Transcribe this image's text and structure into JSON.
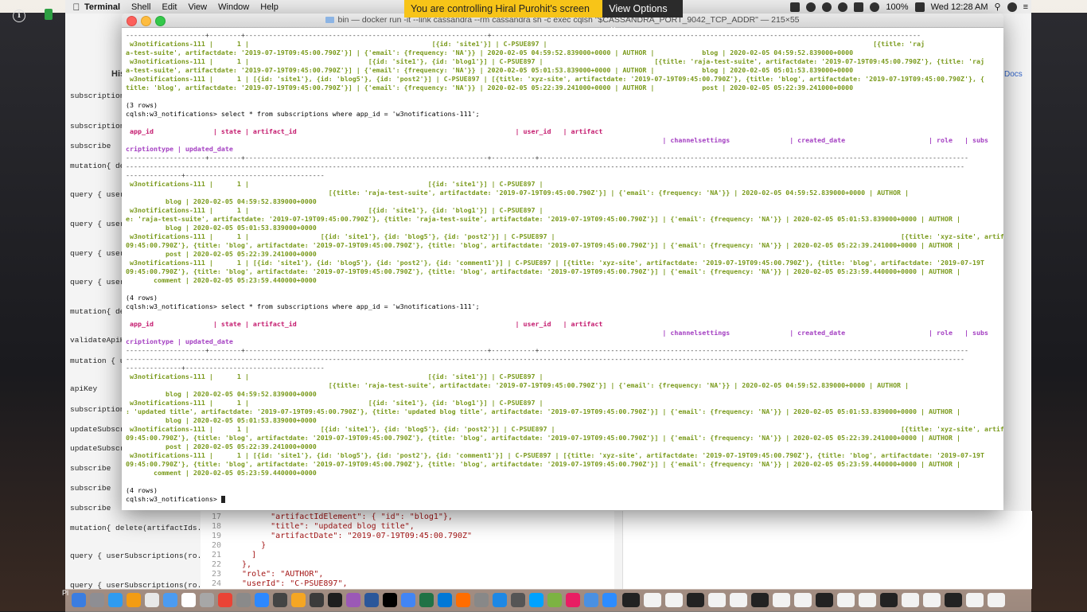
{
  "menubar": {
    "app_name": "Terminal",
    "items": [
      "Shell",
      "Edit",
      "View",
      "Window",
      "Help"
    ],
    "battery": "100%",
    "clock": "Wed 12:28 AM"
  },
  "share_banner": {
    "message": "You are controlling Hiral Purohit's screen",
    "options_label": "View Options"
  },
  "terminal": {
    "title": "bin — docker run -it --link cassandra --rm cassandra sh -c exec cqlsh \"$CASSANDRA_PORT_9042_TCP_ADDR\" — 215×55",
    "lines": [
      {
        "t": "--------------------+--------+-------------------------------------------------------------+------------------------------------------------------------------------------------------------------------",
        "c": "sep"
      },
      {
        "t": " w3notifications-111 |      1 |                                              [{id: 'site1'}] | C-PSUE897 |                                                                                  [{title: 'raj",
        "c": "row"
      },
      {
        "t": "a-test-suite', artifactdate: '2019-07-19T09:45:00.790Z'}] | {'email': {frequency: 'NA'}} | 2020-02-05 04:59:52.839000+0000 | AUTHOR |            blog | 2020-02-05 04:59:52.839000+0000",
        "c": "row"
      },
      {
        "t": " w3notifications-111 |      1 |                              [{id: 'site1'}, {id: 'blog1'}] | C-PSUE897 |                            [{title: 'raja-test-suite', artifactdate: '2019-07-19T09:45:00.790Z'}, {title: 'raj",
        "c": "row"
      },
      {
        "t": "a-test-suite', artifactdate: '2019-07-19T09:45:00.790Z'}] | {'email': {frequency: 'NA'}} | 2020-02-05 05:01:53.839000+0000 | AUTHOR |            blog | 2020-02-05 05:01:53.839000+0000",
        "c": "row"
      },
      {
        "t": " w3notifications-111 |      1 | [{id: 'site1'}, {id: 'blog5'}, {id: 'post2'}] | C-PSUE897 | [{title: 'xyz-site', artifactdate: '2019-07-19T09:45:00.790Z'}, {title: 'blog', artifactdate: '2019-07-19T09:45:00.790Z'}, {",
        "c": "row"
      },
      {
        "t": "title: 'blog', artifactdate: '2019-07-19T09:45:00.790Z'}] | {'email': {frequency: 'NA'}} | 2020-02-05 05:22:39.241000+0000 | AUTHOR |            post | 2020-02-05 05:22:39.241000+0000",
        "c": "row"
      },
      {
        "t": "",
        "c": "rows-count"
      },
      {
        "t": "(3 rows)",
        "c": "rows-count"
      },
      {
        "t": "cqlsh:w3_notifications> select * from subscriptions where app_id = 'w3notifications-111';",
        "c": "prompt"
      },
      {
        "t": "",
        "c": "rows-count"
      },
      {
        "t": " app_id               | state | artifact_id                                                       | user_id   | artifact",
        "c": "hdr-red"
      },
      {
        "t": "                                                                                                                                       | channelsettings               | created_date                     | role   | subs",
        "c": "hdr-mag"
      },
      {
        "t": "criptiontype | updated_date",
        "c": "hdr-mag"
      },
      {
        "t": "--------------------+--------+-------------------------------------------------------------+-----------+------------------------------------------------------------------------------------------------------------",
        "c": "sep"
      },
      {
        "t": "-------------------------------------------------------------------------------------------------------------------------------------------------------------------------------------------------------------------",
        "c": "sep"
      },
      {
        "t": "--------------+-----------------------------------",
        "c": "sep"
      },
      {
        "t": " w3notifications-111 |      1 |                                             [{id: 'site1'}] | C-PSUE897 |",
        "c": "row"
      },
      {
        "t": "                                                   [{title: 'raja-test-suite', artifactdate: '2019-07-19T09:45:00.790Z'}] | {'email': {frequency: 'NA'}} | 2020-02-05 04:59:52.839000+0000 | AUTHOR |",
        "c": "row"
      },
      {
        "t": "          blog | 2020-02-05 04:59:52.839000+0000",
        "c": "row"
      },
      {
        "t": " w3notifications-111 |      1 |                              [{id: 'site1'}, {id: 'blog1'}] | C-PSUE897 |                                                                                                                       [{titl",
        "c": "row"
      },
      {
        "t": "e: 'raja-test-suite', artifactdate: '2019-07-19T09:45:00.790Z'}, {title: 'raja-test-suite', artifactdate: '2019-07-19T09:45:00.790Z'}] | {'email': {frequency: 'NA'}} | 2020-02-05 05:01:53.839000+0000 | AUTHOR |",
        "c": "row"
      },
      {
        "t": "          blog | 2020-02-05 05:01:53.839000+0000",
        "c": "row"
      },
      {
        "t": " w3notifications-111 |      1 |                  [{id: 'site1'}, {id: 'blog5'}, {id: 'post2'}] | C-PSUE897 |                                                                                       [{title: 'xyz-site', artifactdate: '2019-07-19T",
        "c": "row"
      },
      {
        "t": "09:45:00.790Z'}, {title: 'blog', artifactdate: '2019-07-19T09:45:00.790Z'}, {title: 'blog', artifactdate: '2019-07-19T09:45:00.790Z'}] | {'email': {frequency: 'NA'}} | 2020-02-05 05:22:39.241000+0000 | AUTHOR |",
        "c": "row"
      },
      {
        "t": "          post | 2020-02-05 05:22:39.241000+0000",
        "c": "row"
      },
      {
        "t": " w3notifications-111 |      1 | [{id: 'site1'}, {id: 'blog5'}, {id: 'post2'}, {id: 'comment1'}] | C-PSUE897 | [{title: 'xyz-site', artifactdate: '2019-07-19T09:45:00.790Z'}, {title: 'blog', artifactdate: '2019-07-19T",
        "c": "row"
      },
      {
        "t": "09:45:00.790Z'}, {title: 'blog', artifactdate: '2019-07-19T09:45:00.790Z'}, {title: 'blog', artifactdate: '2019-07-19T09:45:00.790Z'}] | {'email': {frequency: 'NA'}} | 2020-02-05 05:23:59.440000+0000 | AUTHOR |",
        "c": "row"
      },
      {
        "t": "       comment | 2020-02-05 05:23:59.440000+0000",
        "c": "row"
      },
      {
        "t": "",
        "c": "rows-count"
      },
      {
        "t": "(4 rows)",
        "c": "rows-count"
      },
      {
        "t": "cqlsh:w3_notifications> select * from subscriptions where app_id = 'w3notifications-111';",
        "c": "prompt"
      },
      {
        "t": "",
        "c": "rows-count"
      },
      {
        "t": " app_id               | state | artifact_id                                                       | user_id   | artifact",
        "c": "hdr-red"
      },
      {
        "t": "                                                                                                                                       | channelsettings               | created_date                     | role   | subs",
        "c": "hdr-mag"
      },
      {
        "t": "criptiontype | updated_date",
        "c": "hdr-mag"
      },
      {
        "t": "--------------------+--------+-------------------------------------------------------------+-----------+------------------------------------------------------------------------------------------------------------",
        "c": "sep"
      },
      {
        "t": "-------------------------------------------------------------------------------------------------------------------------------------------------------------------------------------------------------------------",
        "c": "sep"
      },
      {
        "t": "--------------+-----------------------------------",
        "c": "sep"
      },
      {
        "t": " w3notifications-111 |      1 |                                             [{id: 'site1'}] | C-PSUE897 |",
        "c": "row"
      },
      {
        "t": "                                                   [{title: 'raja-test-suite', artifactdate: '2019-07-19T09:45:00.790Z'}] | {'email': {frequency: 'NA'}} | 2020-02-05 04:59:52.839000+0000 | AUTHOR |",
        "c": "row"
      },
      {
        "t": "          blog | 2020-02-05 04:59:52.839000+0000",
        "c": "row"
      },
      {
        "t": " w3notifications-111 |      1 |                              [{id: 'site1'}, {id: 'blog1'}] | C-PSUE897 |                                                                                                                       [{title",
        "c": "row"
      },
      {
        "t": ": 'updated title', artifactdate: '2019-07-19T09:45:00.790Z'}, {title: 'updated blog title', artifactdate: '2019-07-19T09:45:00.790Z'}] | {'email': {frequency: 'NA'}} | 2020-02-05 05:01:53.839000+0000 | AUTHOR |",
        "c": "row"
      },
      {
        "t": "          blog | 2020-02-05 05:01:53.839000+0000",
        "c": "row"
      },
      {
        "t": " w3notifications-111 |      1 |                  [{id: 'site1'}, {id: 'blog5'}, {id: 'post2'}] | C-PSUE897 |                                                                                       [{title: 'xyz-site', artifactdate: '2019-07-19T",
        "c": "row"
      },
      {
        "t": "09:45:00.790Z'}, {title: 'blog', artifactdate: '2019-07-19T09:45:00.790Z'}, {title: 'blog', artifactdate: '2019-07-19T09:45:00.790Z'}] | {'email': {frequency: 'NA'}} | 2020-02-05 05:22:39.241000+0000 | AUTHOR |",
        "c": "row"
      },
      {
        "t": "          post | 2020-02-05 05:22:39.241000+0000",
        "c": "row"
      },
      {
        "t": " w3notifications-111 |      1 | [{id: 'site1'}, {id: 'blog5'}, {id: 'post2'}, {id: 'comment1'}] | C-PSUE897 | [{title: 'xyz-site', artifactdate: '2019-07-19T09:45:00.790Z'}, {title: 'blog', artifactdate: '2019-07-19T",
        "c": "row"
      },
      {
        "t": "09:45:00.790Z'}, {title: 'blog', artifactdate: '2019-07-19T09:45:00.790Z'}, {title: 'blog', artifactdate: '2019-07-19T09:45:00.790Z'}] | {'email': {frequency: 'NA'}} | 2020-02-05 05:23:59.440000+0000 | AUTHOR |",
        "c": "row"
      },
      {
        "t": "       comment | 2020-02-05 05:23:59.440000+0000",
        "c": "row"
      },
      {
        "t": "",
        "c": "rows-count"
      },
      {
        "t": "(4 rows)",
        "c": "rows-count"
      },
      {
        "t": "cqlsh:w3_notifications> ",
        "c": "prompt",
        "cursor": true
      }
    ]
  },
  "editor": {
    "history_label": "His",
    "docs_label": "Docs",
    "queries": [
      "subscriptions",
      "subscriptions",
      "subscribe",
      "mutation{ dele",
      "query { userS",
      "query { userS",
      "query { userS",
      "query { userS",
      "mutation{ dele",
      "validateApiKe",
      "mutation { ur",
      "apiKey",
      "subscriptions",
      "updateSubscri",
      "updateSubscri",
      "subscribe",
      "subscribe",
      "subscribe",
      "mutation{ delete(artifactIds...",
      "query { userSubscriptions(ro...",
      "query { userSubscriptions(ro..."
    ],
    "code": [
      {
        "n": "17",
        "text": "        \"artifactIdElement\": { \"id\": \"blog1\"},"
      },
      {
        "n": "18",
        "text": "        \"title\": \"updated blog title\","
      },
      {
        "n": "19",
        "text": "        \"artifactDate\": \"2019-07-19T09:45:00.790Z\""
      },
      {
        "n": "20",
        "text": "      }"
      },
      {
        "n": "21",
        "text": "    ]"
      },
      {
        "n": "22",
        "text": "  },"
      },
      {
        "n": "23",
        "text": "  \"role\": \"AUTHOR\","
      },
      {
        "n": "24",
        "text": "  \"userId\": \"C-PSUE897\","
      }
    ]
  },
  "dock": {
    "colors": [
      "#3b7de0",
      "#8e8e93",
      "#2e9bf0",
      "#f39c12",
      "#e8e8e8",
      "#4c9bf0",
      "#ffffff",
      "#a7a7a7",
      "#ea4335",
      "#8a8a8a",
      "#2d88ff",
      "#444444",
      "#f5a623",
      "#3b3b3b",
      "#1e1e1e",
      "#9b59b6",
      "#2b579a",
      "#000000",
      "#4285f4",
      "#207245",
      "#0078d7",
      "#ff6d00",
      "#888888",
      "#1e88e5",
      "#555555",
      "#00a2ff",
      "#7cb342",
      "#e91e63",
      "#4a90e2",
      "#2d8cff"
    ],
    "left_label": "Pl"
  }
}
